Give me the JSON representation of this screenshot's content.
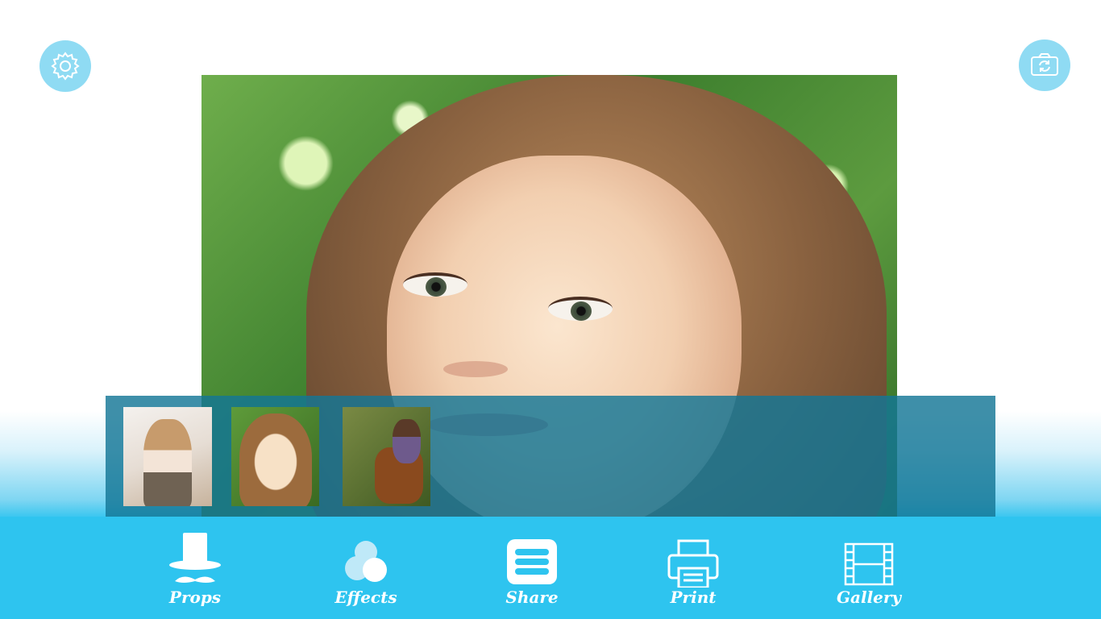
{
  "top_buttons": {
    "settings_icon": "gear-icon",
    "camera_icon": "camera-switch-icon"
  },
  "photo": {
    "description_icon": "main-photo"
  },
  "thumbnails": [
    {
      "id": "thumb-1"
    },
    {
      "id": "thumb-2"
    },
    {
      "id": "thumb-3"
    }
  ],
  "toolbar": {
    "items": [
      {
        "label": "Props",
        "icon": "top-hat-mustache-icon"
      },
      {
        "label": "Effects",
        "icon": "circles-icon"
      },
      {
        "label": "Share",
        "icon": "share-list-icon"
      },
      {
        "label": "Print",
        "icon": "printer-icon"
      },
      {
        "label": "Gallery",
        "icon": "film-strip-icon"
      }
    ]
  },
  "colors": {
    "toolbar_bg": "#2ec4ef",
    "strip_bg": "#147696",
    "round_btn_bg": "#8fdbf3",
    "icon_fg": "#ffffff"
  }
}
